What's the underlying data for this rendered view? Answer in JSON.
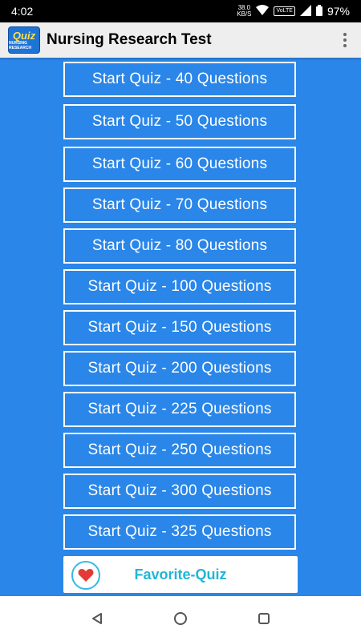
{
  "status_bar": {
    "time": "4:02",
    "net_speed": "38.0",
    "net_unit": "KB/S",
    "volte": "VoLTE",
    "battery": "97%"
  },
  "app_bar": {
    "logo_top": "Quiz",
    "logo_bottom": "NURSING RESEARCH",
    "title": "Nursing Research Test"
  },
  "quizzes": [
    "Start Quiz - 40 Questions",
    "Start Quiz - 50 Questions",
    "Start Quiz - 60 Questions",
    "Start Quiz - 70 Questions",
    "Start Quiz - 80 Questions",
    "Start Quiz - 100 Questions",
    "Start Quiz - 150 Questions",
    "Start Quiz - 200 Questions",
    "Start Quiz - 225 Questions",
    "Start Quiz - 250 Questions",
    "Start Quiz - 300 Questions",
    "Start Quiz - 325 Questions"
  ],
  "favorite": {
    "label": "Favorite-Quiz",
    "icon": "heart-icon"
  },
  "nav_bar": {
    "icons": [
      "back-icon",
      "home-icon",
      "recents-icon"
    ]
  },
  "colors": {
    "background": "#2a86e8",
    "button_border": "#ffffff",
    "favorite_text": "#1fb6d6",
    "heart": "#e53935"
  }
}
